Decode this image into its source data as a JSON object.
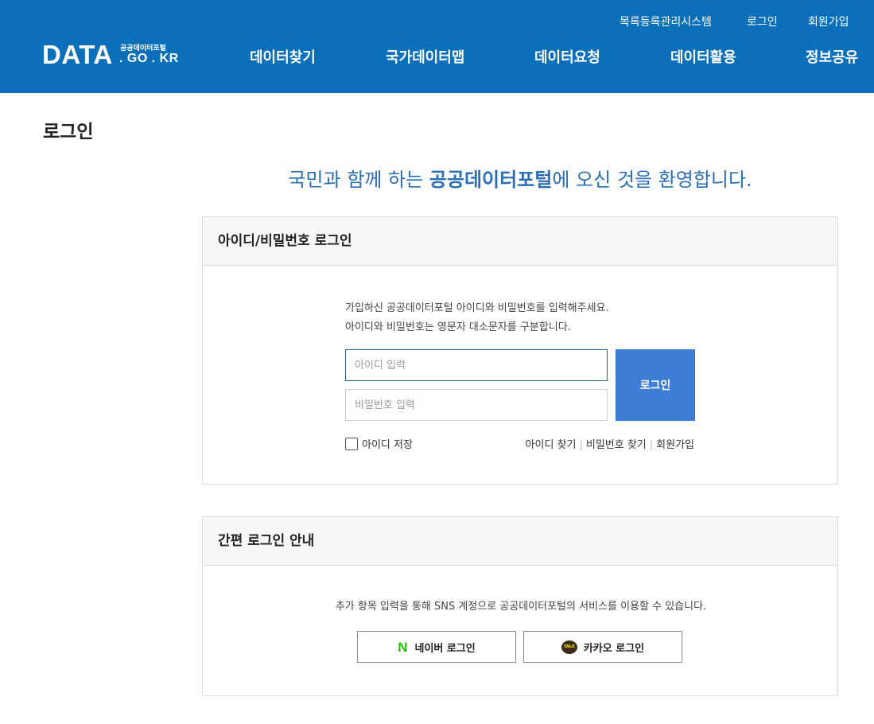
{
  "header": {
    "util_links": [
      "목록등록관리시스템",
      "로그인",
      "회원가입"
    ],
    "logo": {
      "main": "DATA",
      "sub_top": "공공데이터포털",
      "sub_bottom": ". GO . KR"
    },
    "nav": [
      "데이터찾기",
      "국가데이터맵",
      "데이터요청",
      "데이터활용",
      "정보공유"
    ],
    "bg_color": "#0b70b9"
  },
  "page": {
    "title": "로그인",
    "welcome_pre": "국민과 함께 하는 ",
    "welcome_bold": "공공데이터포털",
    "welcome_post": "에 오신 것을 환영합니다."
  },
  "login_panel": {
    "heading": "아이디/비밀번호 로그인",
    "guide_line1": "가입하신 공공데이터포털 아이디와 비밀번호를 입력해주세요.",
    "guide_line2": "아이디와 비밀번호는 영문자 대소문자를 구분합니다.",
    "id_placeholder": "아이디 입력",
    "pw_placeholder": "비밀번호 입력",
    "login_button": "로그인",
    "remember_label": "아이디 저장",
    "find_id": "아이디 찾기",
    "find_pw": "비밀번호 찾기",
    "join": "회원가입",
    "button_color": "#3e7dd6"
  },
  "sns_panel": {
    "heading": "간편 로그인 안내",
    "guide": "추가 항목 입력을 통해 SNS 계정으로 공공데이터포털의 서비스를 이용할 수 있습니다.",
    "naver_icon": "N",
    "naver_label": "네이버 로그인",
    "kakao_label": "카카오 로그인"
  }
}
